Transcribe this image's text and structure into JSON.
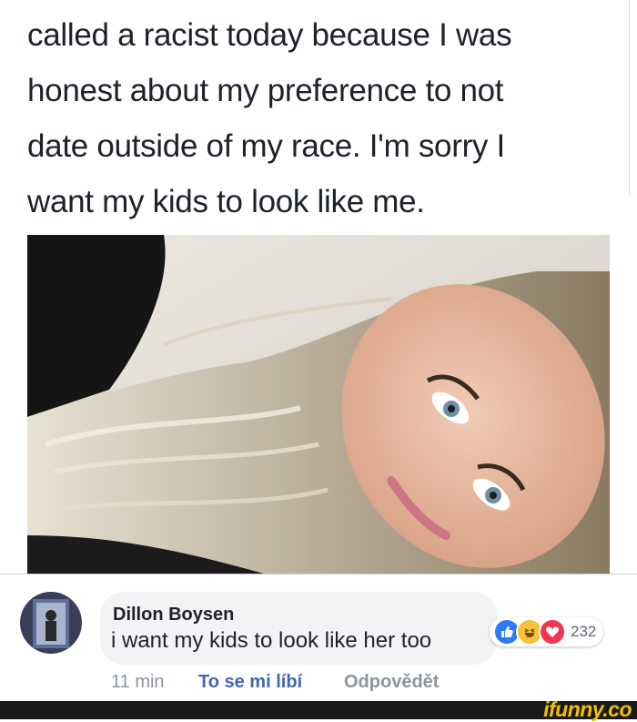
{
  "post": {
    "text": "called a racist today because I was\nhonest about my preference to not\ndate outside of my race. I'm sorry I\nwant my kids to look like me."
  },
  "comment": {
    "author": "Dillon Boysen",
    "text": "i want my kids to look like her too",
    "reactions": {
      "icons": [
        "like-icon",
        "haha-icon",
        "love-icon"
      ],
      "count": "232"
    },
    "time": "11 min",
    "like_label": "To se mi líbí",
    "reply_label": "Odpovědět"
  },
  "footer": {
    "logo": "ifunny.co"
  },
  "colors": {
    "link": "#4267b2",
    "like": "#2d7cf6",
    "haha": "#f7c23a",
    "love": "#f0364f",
    "logo": "#f4c100"
  }
}
